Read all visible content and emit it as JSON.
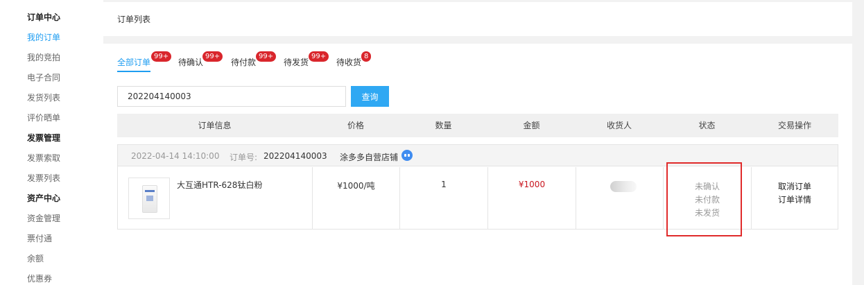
{
  "sidebar": {
    "items": [
      {
        "label": "订单中心",
        "type": "group"
      },
      {
        "label": "我的订单",
        "type": "active"
      },
      {
        "label": "我的竞拍",
        "type": "link"
      },
      {
        "label": "电子合同",
        "type": "link"
      },
      {
        "label": "发货列表",
        "type": "link"
      },
      {
        "label": "评价晒单",
        "type": "link"
      },
      {
        "label": "发票管理",
        "type": "group"
      },
      {
        "label": "发票索取",
        "type": "link"
      },
      {
        "label": "发票列表",
        "type": "link"
      },
      {
        "label": "资产中心",
        "type": "group"
      },
      {
        "label": "资金管理",
        "type": "link"
      },
      {
        "label": "票付通",
        "type": "link"
      },
      {
        "label": "余额",
        "type": "link"
      },
      {
        "label": "优惠券",
        "type": "link"
      }
    ]
  },
  "header": {
    "title": "订单列表"
  },
  "tabs": [
    {
      "label": "全部订单",
      "badge": "99+",
      "active": true
    },
    {
      "label": "待确认",
      "badge": "99+",
      "active": false
    },
    {
      "label": "待付款",
      "badge": "99+",
      "active": false
    },
    {
      "label": "待发货",
      "badge": "99+",
      "active": false
    },
    {
      "label": "待收货",
      "badge": "8",
      "active": false
    }
  ],
  "search": {
    "value": "202204140003",
    "button_label": "查询"
  },
  "table": {
    "headers": [
      "订单信息",
      "价格",
      "数量",
      "金额",
      "收货人",
      "状态",
      "交易操作"
    ]
  },
  "order": {
    "date": "2022-04-14 14:10:00",
    "order_no_label": "订单号:",
    "order_no": "202204140003",
    "shop": "涂多多自营店铺",
    "product_name": "大互通HTR-628钛白粉",
    "price": "¥1000/吨",
    "quantity": "1",
    "amount": "¥1000",
    "status": [
      "未确认",
      "未付款",
      "未发货"
    ],
    "actions": [
      "取消订单",
      "订单详情"
    ]
  },
  "colors": {
    "accent": "#1e9df1",
    "badge": "#d9262c",
    "amount": "#c9151e",
    "highlight": "#e02a2a"
  }
}
